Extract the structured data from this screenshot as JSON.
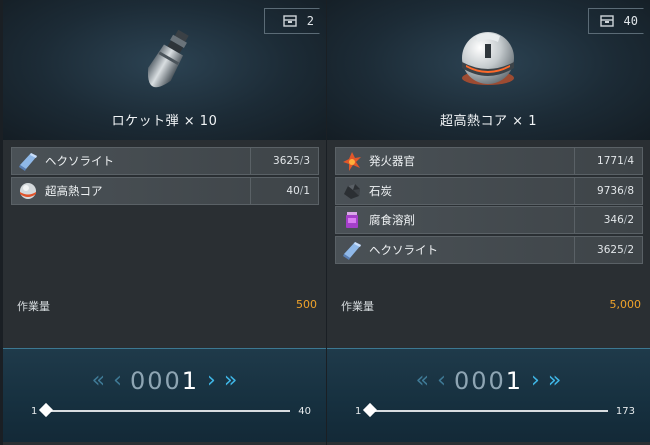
{
  "panels": [
    {
      "item": {
        "name": "ロケット弾 × 10",
        "image": "rocket-shell"
      },
      "quantity": "2",
      "materials": [
        {
          "icon": "hexolite-icon",
          "name": "ヘクソライト",
          "have": "3625",
          "need": "3"
        },
        {
          "icon": "super-heat-core-icon",
          "name": "超高熱コア",
          "have": "40",
          "need": "1"
        }
      ],
      "workload_label": "作業量",
      "workload_value": "500",
      "counter": {
        "dim": "000",
        "strong": "1"
      },
      "slider": {
        "min": "1",
        "max": "40",
        "value": 1
      }
    },
    {
      "item": {
        "name": "超高熱コア × 1",
        "image": "super-heat-core"
      },
      "quantity": "40",
      "materials": [
        {
          "icon": "igniter-icon",
          "name": "発火器官",
          "have": "1771",
          "need": "4"
        },
        {
          "icon": "coal-icon",
          "name": "石炭",
          "have": "9736",
          "need": "8"
        },
        {
          "icon": "corrosive-solvent-icon",
          "name": "腐食溶剤",
          "have": "346",
          "need": "2"
        },
        {
          "icon": "hexolite-icon",
          "name": "ヘクソライト",
          "have": "3625",
          "need": "2"
        }
      ],
      "workload_label": "作業量",
      "workload_value": "5,000",
      "counter": {
        "dim": "000",
        "strong": "1"
      },
      "slider": {
        "min": "1",
        "max": "173",
        "value": 1
      }
    }
  ],
  "colors": {
    "accent": "#3fb6e6",
    "workload": "#f0a32a"
  },
  "icons": {
    "first": "«",
    "prev": "‹",
    "next": "›",
    "last": "»"
  }
}
